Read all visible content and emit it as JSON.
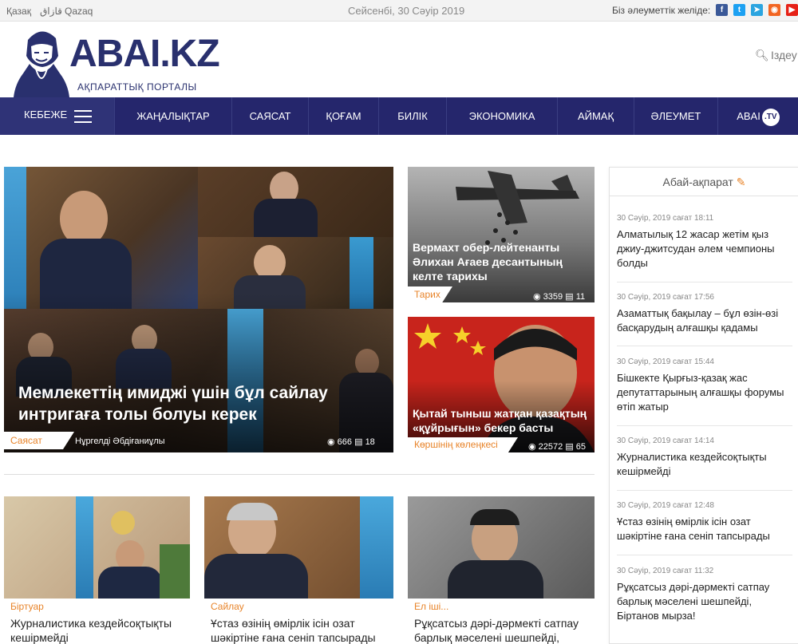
{
  "topbar": {
    "langs": [
      "Қазақ",
      "قازاق",
      "Qazaq"
    ],
    "date": "Сейсенбі, 30 Сәуір 2019",
    "social_label": "Біз әлеуметтік желіде:",
    "social_icons": [
      "facebook-icon",
      "twitter-icon",
      "telegram-icon",
      "rss-icon",
      "youtube-icon"
    ],
    "social_colors": [
      "#3b5998",
      "#1da1f2",
      "#2ca5e0",
      "#f26522",
      "#e62117"
    ]
  },
  "header": {
    "logo_text": "ABAI.KZ",
    "logo_sub": "АҚПАРАТТЫҚ ПОРТАЛЫ",
    "search_label": "Іздеу"
  },
  "nav": {
    "menu_label": "КЕБЕЖЕ",
    "items": [
      "ЖАҢАЛЫҚТАР",
      "САЯСАТ",
      "ҚОҒАМ",
      "БИЛІК",
      "ЭКОНОМИКА",
      "АЙМАҚ",
      "ӘЛЕУМЕТ",
      "ABAI"
    ],
    "tv_badge": ".TV"
  },
  "feature": {
    "title": "Мемлекеттің имиджі үшін бұл сайлау интригаға толы болуы керек",
    "category": "Саясат",
    "author": "Нұргелді Әбдіғаниұлы",
    "views": "666",
    "comments": "18"
  },
  "cards": [
    {
      "title": "Вермахт обер-лейтенанты Әлихан Ағаев десантының келте тарихы",
      "category": "Тарих",
      "views": "3359",
      "comments": "11"
    },
    {
      "title": "Қытай тыныш жатқан қазақтың «құйрығын» бекер басты",
      "category": "Көршінің көлеңкесі",
      "views": "22572",
      "comments": "65"
    }
  ],
  "sidebar": {
    "title": "Абай-ақпарат",
    "items": [
      {
        "time": "30 Сәуір, 2019 сағат 18:11",
        "text": "Алматылық 12 жасар жетім қыз джиу-джитсудан әлем чемпионы болды"
      },
      {
        "time": "30 Сәуір, 2019 сағат 17:56",
        "text": "Азаматтық бақылау – бұл өзін-өзі басқарудың алғашқы қадамы"
      },
      {
        "time": "30 Сәуір, 2019 сағат 15:44",
        "text": "Бішкекте Қырғыз-қазақ жас депутаттарының алғашқы форумы өтіп жатыр"
      },
      {
        "time": "30 Сәуір, 2019 сағат 14:14",
        "text": "Журналистика кездейсоқтықты кешірмейді"
      },
      {
        "time": "30 Сәуір, 2019 сағат 12:48",
        "text": "Ұстаз өзінің өмірлік ісін озат шәкіртіне ғана сеніп тапсырады"
      },
      {
        "time": "30 Сәуір, 2019 сағат 11:32",
        "text": "Рұқсатсыз дәрі-дәрмекті сатпау барлық мәселені шешпейді, Біртанов мырза!"
      }
    ]
  },
  "bottom": [
    {
      "category": "Біртуар",
      "title": "Журналистика кездейсоқтықты кешірмейді"
    },
    {
      "category": "Сайлау",
      "title": "Ұстаз өзінің өмірлік ісін озат шәкіртіне ғана сеніп тапсырады"
    },
    {
      "category": "Ел іші...",
      "title": "Рұқсатсыз дәрі-дәрмекті сатпау барлық мәселені шешпейді, Біртанов мырза!"
    }
  ]
}
